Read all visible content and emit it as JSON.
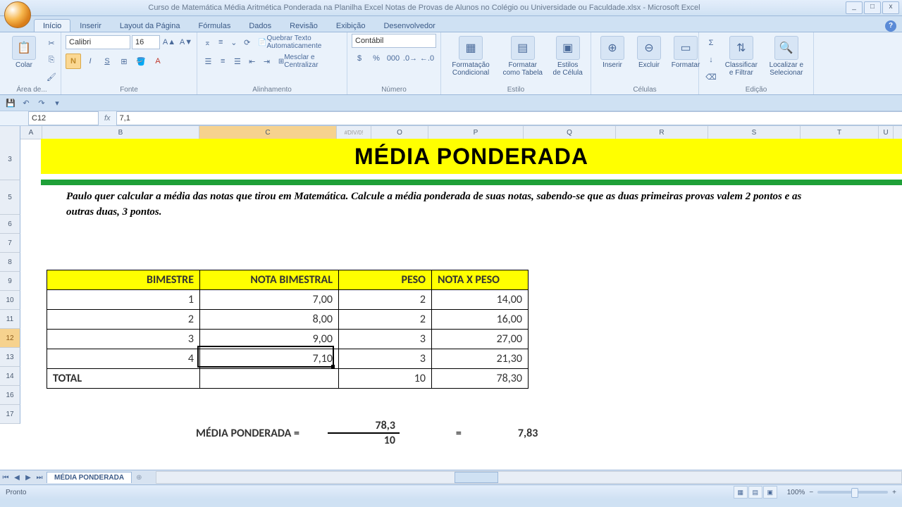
{
  "window": {
    "title": "Curso de Matemática Média Aritmética Ponderada na Planilha Excel Notas de Provas de Alunos no Colégio ou Universidade ou Faculdade.xlsx - Microsoft Excel"
  },
  "ribbon_tabs": [
    "Início",
    "Inserir",
    "Layout da Página",
    "Fórmulas",
    "Dados",
    "Revisão",
    "Exibição",
    "Desenvolvedor"
  ],
  "ribbon": {
    "clipboard": {
      "paste": "Colar",
      "group": "Área de..."
    },
    "font": {
      "name": "Calibri",
      "size": "16",
      "group": "Fonte"
    },
    "align": {
      "wrap": "Quebrar Texto Automaticamente",
      "merge": "Mesclar e Centralizar",
      "group": "Alinhamento"
    },
    "number": {
      "format": "Contábil",
      "group": "Número"
    },
    "styles": {
      "cond": "Formatação Condicional",
      "table": "Formatar como Tabela",
      "cell": "Estilos de Célula",
      "group": "Estilo"
    },
    "cells": {
      "insert": "Inserir",
      "delete": "Excluir",
      "format": "Formatar",
      "group": "Células"
    },
    "editing": {
      "sort": "Classificar e Filtrar",
      "find": "Localizar e Selecionar",
      "group": "Edição"
    }
  },
  "cell_ref": "C12",
  "formula": "7,1",
  "columns": [
    "A",
    "B",
    "C",
    "O",
    "P",
    "Q",
    "R",
    "S",
    "T",
    "U"
  ],
  "col_extra": "#DIV/0!",
  "rows": [
    "3",
    "5",
    "6",
    "7",
    "8",
    "9",
    "10",
    "11",
    "12",
    "13",
    "14",
    "16",
    "17"
  ],
  "sheet": {
    "title": "MÉDIA PONDERADA",
    "problem": "Paulo quer calcular a média das notas que tirou em Matemática. Calcule a média ponderada de suas notas, sabendo-se que as duas primeiras provas valem 2 pontos e as outras duas, 3 pontos.",
    "headers": [
      "BIMESTRE",
      "NOTA BIMESTRAL",
      "PESO",
      "NOTA X PESO"
    ],
    "data": [
      [
        "1",
        "7,00",
        "2",
        "14,00"
      ],
      [
        "2",
        "8,00",
        "2",
        "16,00"
      ],
      [
        "3",
        "9,00",
        "3",
        "27,00"
      ],
      [
        "4",
        "7,10",
        "3",
        "21,30"
      ]
    ],
    "total_row": [
      "TOTAL",
      "",
      "10",
      "78,30"
    ],
    "result": {
      "label": "MÉDIA PONDERADA =",
      "num": "78,3",
      "den": "10",
      "eq": "=",
      "value": "7,83"
    }
  },
  "sheet_tab": "MÉDIA PONDERADA",
  "status": {
    "ready": "Pronto",
    "zoom": "100%"
  }
}
